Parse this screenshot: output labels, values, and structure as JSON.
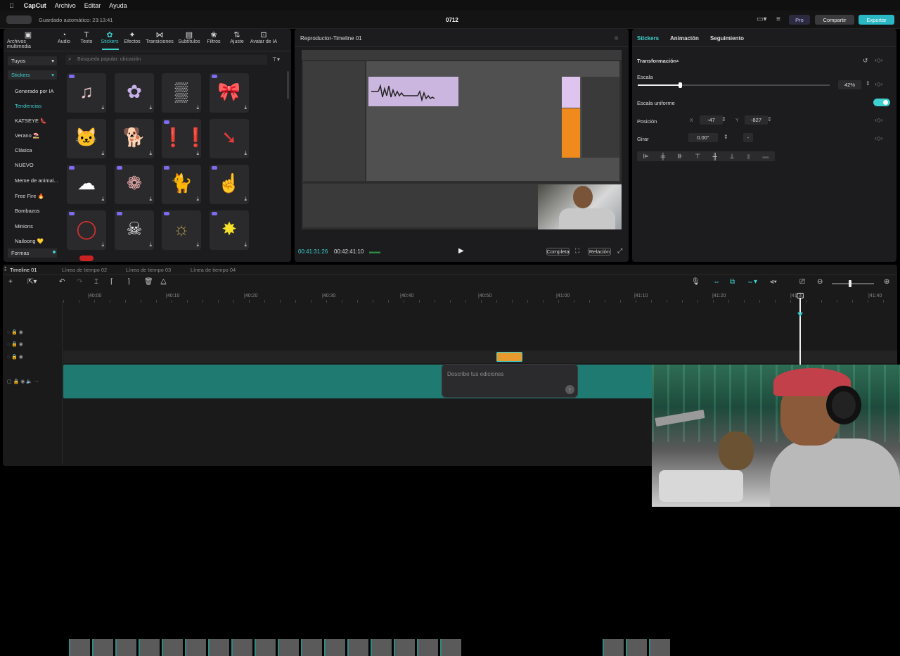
{
  "menubar": {
    "app": "CapCut",
    "items": [
      "Archivo",
      "Editar",
      "Ayuda"
    ]
  },
  "topbar": {
    "autosave": "Guardado automático: 23:13:41",
    "project": "0712",
    "pro": "Pro",
    "share": "Compartir",
    "export": "Exportar"
  },
  "toolbar": [
    {
      "label": "Archivos multimedia",
      "icon": "media-icon"
    },
    {
      "label": "Audio",
      "icon": "audio-icon"
    },
    {
      "label": "Texto",
      "icon": "text-icon"
    },
    {
      "label": "Stickers",
      "icon": "sticker-icon"
    },
    {
      "label": "Efectos",
      "icon": "effects-icon"
    },
    {
      "label": "Transiciones",
      "icon": "transitions-icon"
    },
    {
      "label": "Subtítulos",
      "icon": "subtitles-icon"
    },
    {
      "label": "Filtros",
      "icon": "filters-icon"
    },
    {
      "label": "Ajuste",
      "icon": "adjust-icon"
    },
    {
      "label": "Avatar de IA",
      "icon": "avatar-icon"
    }
  ],
  "sidebar": {
    "dropdown1": "Tuyos",
    "dropdown2": "Stickers",
    "categories": [
      "Generado por IA",
      "Tendencias",
      "KATSEYE 👠",
      "Verano ⛱️",
      "Clásica",
      "NUEVO",
      "Meme de animal...",
      "Free Fire 🔥",
      "Bombazos",
      "Minions",
      "Nailoong 💛",
      "Formas"
    ]
  },
  "search": {
    "placeholder": "Búsqueda popular: ubicación"
  },
  "player": {
    "title": "Reproductor-Timeline 01",
    "current_time": "00:41:31:26",
    "total_time": "00:42:41:10",
    "full": "Completa",
    "ratio": "Relación"
  },
  "inspector": {
    "tabs": [
      "Stickers",
      "Animación",
      "Seguimiento"
    ],
    "section": "Transformación",
    "scale_label": "Escala",
    "scale_value": "42%",
    "scale_fraction": 0.42,
    "uniform_label": "Escala uniforme",
    "position_label": "Posición",
    "pos_x_label": "X",
    "pos_x": "-47",
    "pos_y_label": "Y",
    "pos_y": "-827",
    "rotate_label": "Girar",
    "rotate_value": "0.00°",
    "rotate_sep": "-"
  },
  "timeline": {
    "tabs": [
      "Timeline 01",
      "Línea de tiempo 02",
      "Línea de tiempo 03",
      "Línea de tiempo 04"
    ],
    "ticks": [
      "|40:00",
      "|40:10",
      "|40:20",
      "|40:30",
      "|40:40",
      "|40:50",
      "|41:00",
      "|41:10",
      "|41:20",
      "|41:30",
      "|41:40"
    ],
    "prompt_placeholder": "Describe tus ediciones",
    "playhead_fraction": 0.82
  },
  "colors": {
    "accent": "#3ecfcf",
    "track": "#1f7a72",
    "export": "#2ab9c4",
    "pro": "#7b6cf0"
  }
}
